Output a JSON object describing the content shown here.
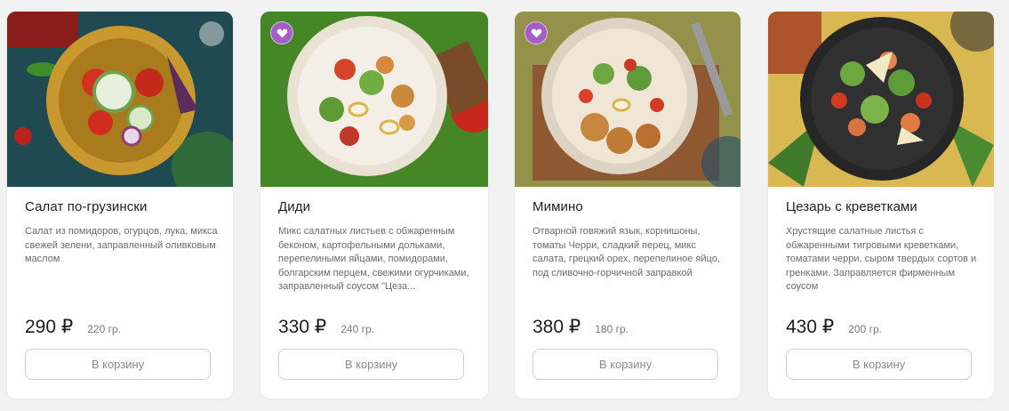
{
  "colors": {
    "favorite": "#a45ec5",
    "card_bg": "#ffffff",
    "page_bg": "#f2f2f2"
  },
  "products": [
    {
      "title": "Салат по-грузински",
      "description": "Салат из помидоров, огурцов, лука, микса свежей зелени, заправленный оливковым маслом",
      "price": "290 ₽",
      "weight": "220 гр.",
      "button_label": "В корзину",
      "favorite": false
    },
    {
      "title": "Диди",
      "description": "Микс салатных листьев с обжаренным беконом, картофельными дольками, перепелиными яйцами, помидорами, болгарским перцем, свежими огурчиками, заправленный соусом \"Цеза...",
      "price": "330 ₽",
      "weight": "240 гр.",
      "button_label": "В корзину",
      "favorite": true
    },
    {
      "title": "Мимино",
      "description": "Отварной говяжий язык, корнишоны, томаты Черри, сладкий перец, микс салата, грецкий орех, перепелиное яйцо, под сливочно-горчичной заправкой",
      "price": "380 ₽",
      "weight": "180 гр.",
      "button_label": "В корзину",
      "favorite": true
    },
    {
      "title": "Цезарь с креветками",
      "description": "Хрустящие салатные листья с обжаренными тигровыми креветками, томатами черри, сыром твердых сортов и гренками. Заправляется фирменным соусом",
      "price": "430 ₽",
      "weight": "200 гр.",
      "button_label": "В корзину",
      "favorite": false
    }
  ]
}
